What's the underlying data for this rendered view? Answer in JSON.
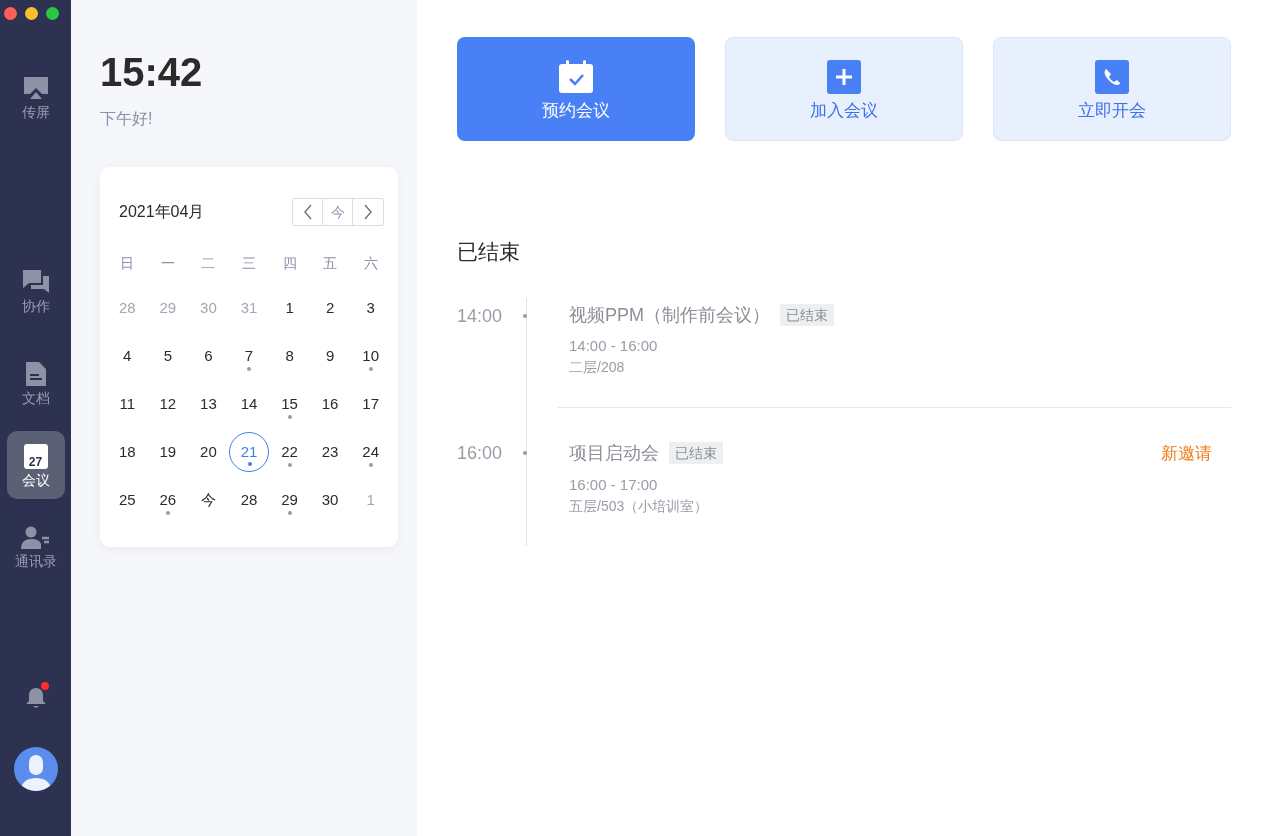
{
  "sidebar": {
    "items": [
      {
        "label": "传屏",
        "kind": "screen",
        "selected": false
      },
      {
        "label": "协作",
        "kind": "chat",
        "selected": false
      },
      {
        "label": "文档",
        "kind": "doc",
        "selected": false
      },
      {
        "label": "会议",
        "kind": "calendar",
        "icon_text": "27",
        "selected": true
      },
      {
        "label": "通讯录",
        "kind": "contacts",
        "selected": false
      }
    ],
    "notification": {
      "unread": true
    }
  },
  "clock": {
    "time": "15:42",
    "greeting": "下午好!"
  },
  "calendar": {
    "month": "2021年04月",
    "today_button": "今",
    "weekdays": [
      "日",
      "一",
      "二",
      "三",
      "四",
      "五",
      "六"
    ],
    "days": [
      {
        "text": "28",
        "muted": true,
        "dot": false,
        "selected": false
      },
      {
        "text": "29",
        "muted": true,
        "dot": false,
        "selected": false
      },
      {
        "text": "30",
        "muted": true,
        "dot": false,
        "selected": false
      },
      {
        "text": "31",
        "muted": true,
        "dot": false,
        "selected": false
      },
      {
        "text": "1",
        "muted": false,
        "dot": false,
        "selected": false
      },
      {
        "text": "2",
        "muted": false,
        "dot": false,
        "selected": false
      },
      {
        "text": "3",
        "muted": false,
        "dot": false,
        "selected": false
      },
      {
        "text": "4",
        "muted": false,
        "dot": false,
        "selected": false
      },
      {
        "text": "5",
        "muted": false,
        "dot": false,
        "selected": false
      },
      {
        "text": "6",
        "muted": false,
        "dot": false,
        "selected": false
      },
      {
        "text": "7",
        "muted": false,
        "dot": true,
        "selected": false
      },
      {
        "text": "8",
        "muted": false,
        "dot": false,
        "selected": false
      },
      {
        "text": "9",
        "muted": false,
        "dot": false,
        "selected": false
      },
      {
        "text": "10",
        "muted": false,
        "dot": true,
        "selected": false
      },
      {
        "text": "11",
        "muted": false,
        "dot": false,
        "selected": false
      },
      {
        "text": "12",
        "muted": false,
        "dot": false,
        "selected": false
      },
      {
        "text": "13",
        "muted": false,
        "dot": false,
        "selected": false
      },
      {
        "text": "14",
        "muted": false,
        "dot": false,
        "selected": false
      },
      {
        "text": "15",
        "muted": false,
        "dot": true,
        "selected": false
      },
      {
        "text": "16",
        "muted": false,
        "dot": false,
        "selected": false
      },
      {
        "text": "17",
        "muted": false,
        "dot": false,
        "selected": false
      },
      {
        "text": "18",
        "muted": false,
        "dot": false,
        "selected": false
      },
      {
        "text": "19",
        "muted": false,
        "dot": false,
        "selected": false
      },
      {
        "text": "20",
        "muted": false,
        "dot": false,
        "selected": false
      },
      {
        "text": "21",
        "muted": false,
        "dot": true,
        "selected": true
      },
      {
        "text": "22",
        "muted": false,
        "dot": true,
        "selected": false
      },
      {
        "text": "23",
        "muted": false,
        "dot": false,
        "selected": false
      },
      {
        "text": "24",
        "muted": false,
        "dot": true,
        "selected": false
      },
      {
        "text": "25",
        "muted": false,
        "dot": false,
        "selected": false
      },
      {
        "text": "26",
        "muted": false,
        "dot": true,
        "selected": false
      },
      {
        "text": "今",
        "muted": false,
        "dot": false,
        "selected": false
      },
      {
        "text": "28",
        "muted": false,
        "dot": false,
        "selected": false
      },
      {
        "text": "29",
        "muted": false,
        "dot": true,
        "selected": false
      },
      {
        "text": "30",
        "muted": false,
        "dot": false,
        "selected": false
      },
      {
        "text": "1",
        "muted": true,
        "dot": false,
        "selected": false
      }
    ]
  },
  "actions": [
    {
      "label": "预约会议",
      "kind": "schedule",
      "primary": true
    },
    {
      "label": "加入会议",
      "kind": "join",
      "primary": false
    },
    {
      "label": "立即开会",
      "kind": "call",
      "primary": false
    }
  ],
  "section_title": "已结束",
  "meetings": [
    {
      "time": "14:00",
      "title": "视频PPM（制作前会议）",
      "status": "已结束",
      "range": "14:00 - 16:00",
      "location": "二层/208"
    },
    {
      "time": "16:00",
      "title": "项目启动会",
      "status": "已结束",
      "range": "16:00 - 17:00",
      "location": "五层/503（小培训室）",
      "action": "新邀请"
    }
  ]
}
